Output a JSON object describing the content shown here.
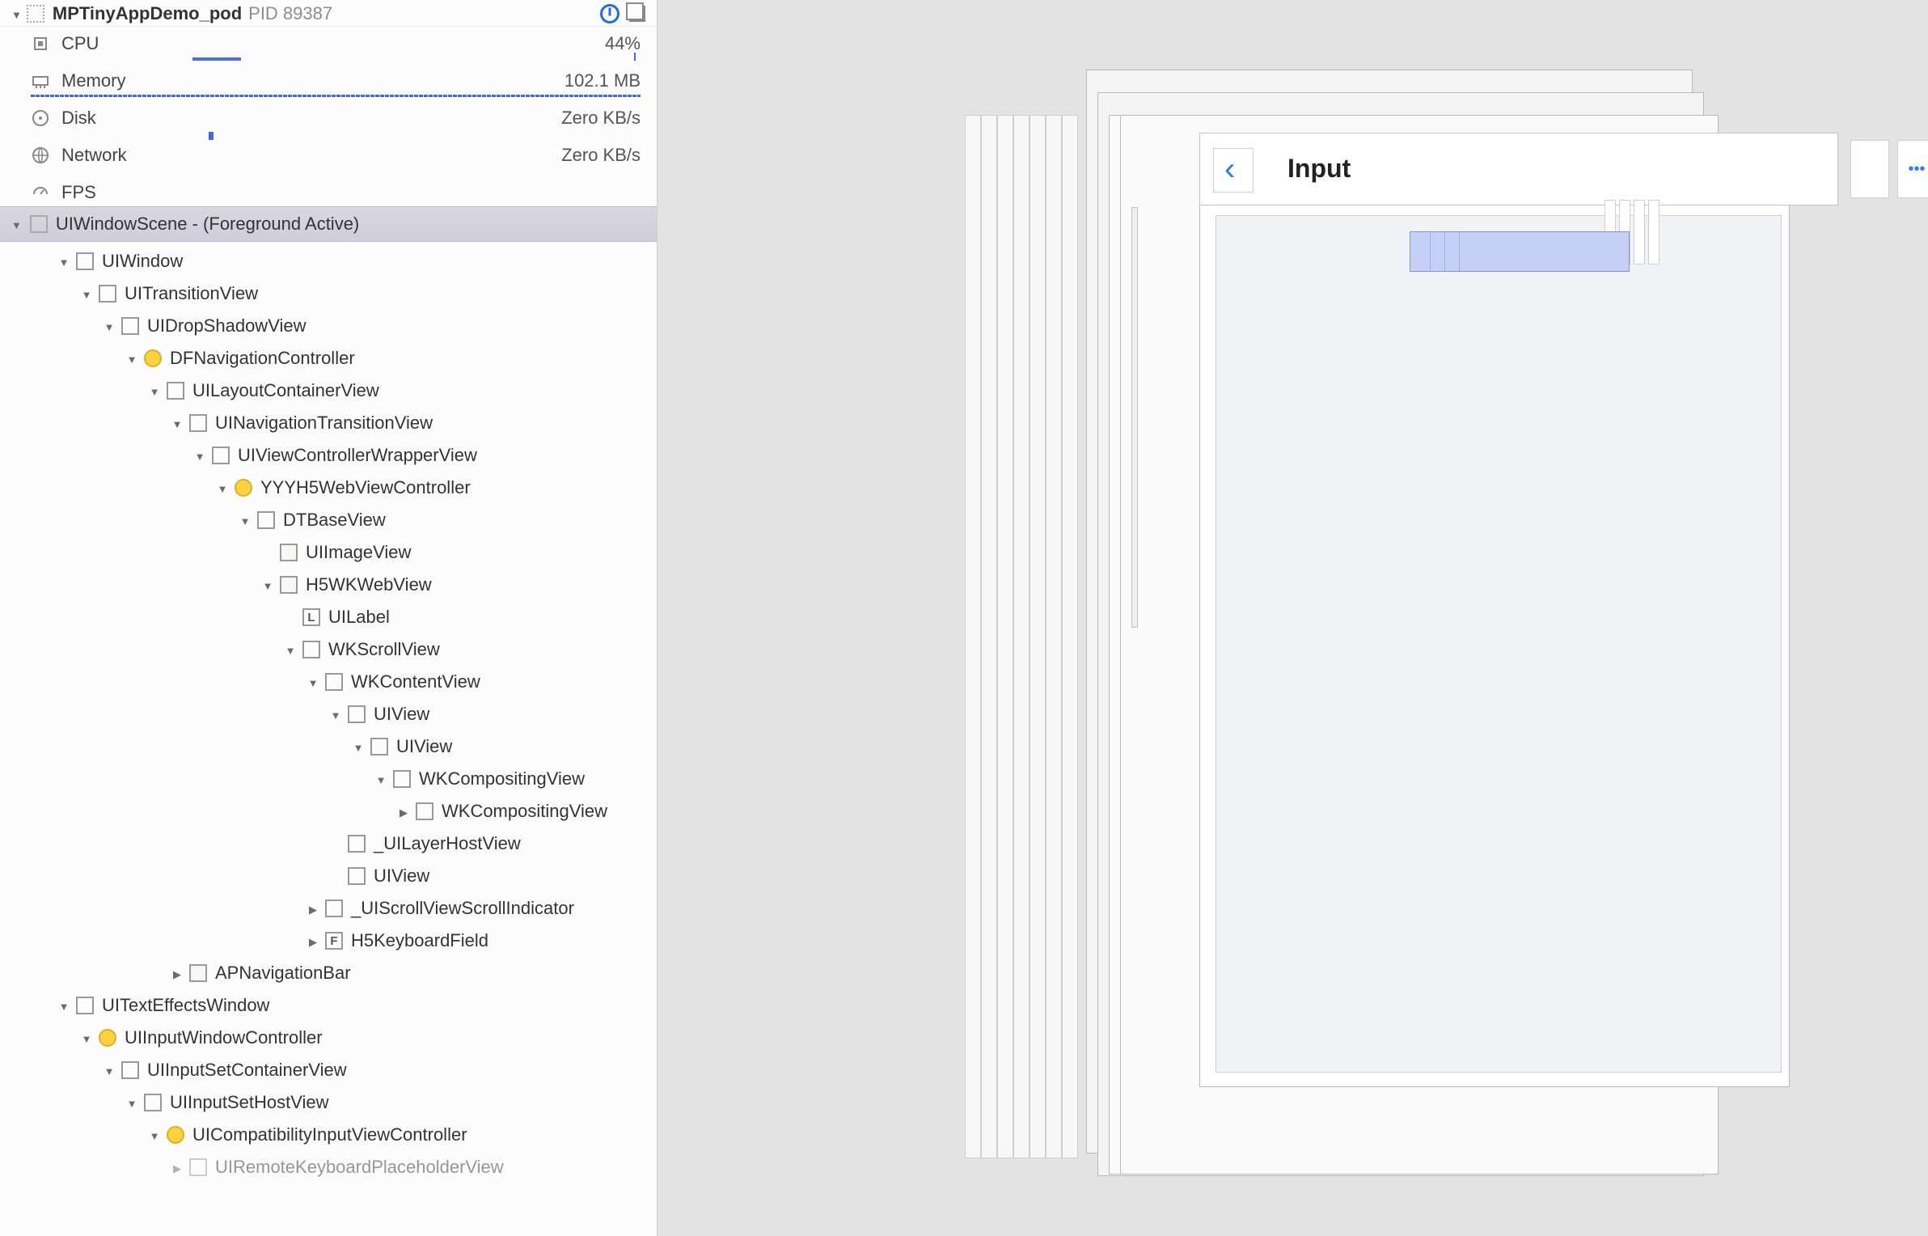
{
  "header": {
    "app_name": "MPTinyAppDemo_pod",
    "pid_label": "PID 89387"
  },
  "metrics": {
    "cpu": {
      "label": "CPU",
      "value": "44%"
    },
    "memory": {
      "label": "Memory",
      "value": "102.1 MB"
    },
    "disk": {
      "label": "Disk",
      "value": "Zero KB/s"
    },
    "network": {
      "label": "Network",
      "value": "Zero KB/s"
    },
    "fps": {
      "label": "FPS",
      "value": ""
    }
  },
  "scene": {
    "label": "UIWindowScene - (Foreground Active)"
  },
  "tree": {
    "n0": "UIWindow",
    "n1": "UITransitionView",
    "n2": "UIDropShadowView",
    "n3": "DFNavigationController",
    "n4": "UILayoutContainerView",
    "n5": "UINavigationTransitionView",
    "n6": "UIViewControllerWrapperView",
    "n7": "YYYH5WebViewController",
    "n8": "DTBaseView",
    "n9": "UIImageView",
    "n10": "H5WKWebView",
    "n11": "UILabel",
    "n12": "WKScrollView",
    "n13": "WKContentView",
    "n14": "UIView",
    "n15": "UIView",
    "n16": "WKCompositingView",
    "n17": "WKCompositingView",
    "n18": "_UILayerHostView",
    "n19": "UIView",
    "n20": "_UIScrollViewScrollIndicator",
    "n21": "H5KeyboardField",
    "n22": "APNavigationBar",
    "n23": "UITextEffectsWindow",
    "n24": "UIInputWindowController",
    "n25": "UIInputSetContainerView",
    "n26": "UIInputSetHostView",
    "n27": "UICompatibilityInputViewController",
    "n28": "UIRemoteKeyboardPlaceholderView"
  },
  "canvas": {
    "controller_label": "YYYH5WebViewController",
    "nav_title": "Input"
  }
}
